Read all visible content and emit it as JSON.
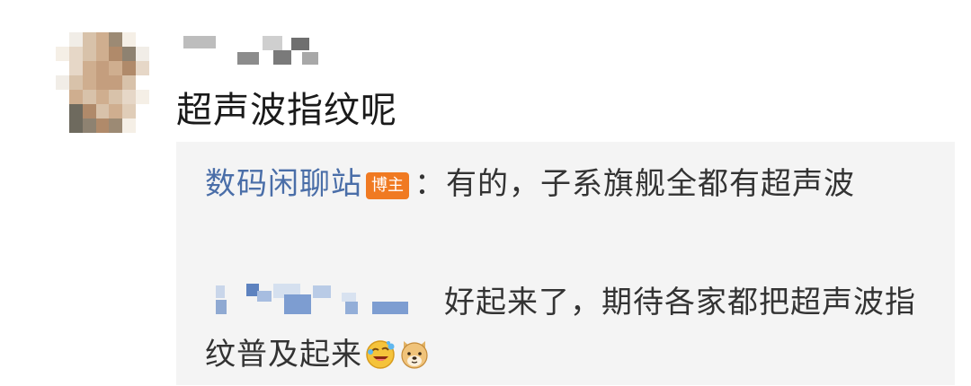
{
  "comment": {
    "text": "超声波指纹呢"
  },
  "replies": [
    {
      "author": "数码闲聊站",
      "badge": "博主",
      "separator": "：",
      "text": "有的，子系旗舰全都有超声波"
    },
    {
      "text": "好起来了，期待各家都把超声波指纹普及起来",
      "emojis": [
        "laughing-crying-emoji",
        "doge-emoji"
      ]
    }
  ],
  "colors": {
    "author_link": "#4a6ea8",
    "badge_bg": "#f07a22",
    "reply_bg": "#f4f4f4"
  }
}
